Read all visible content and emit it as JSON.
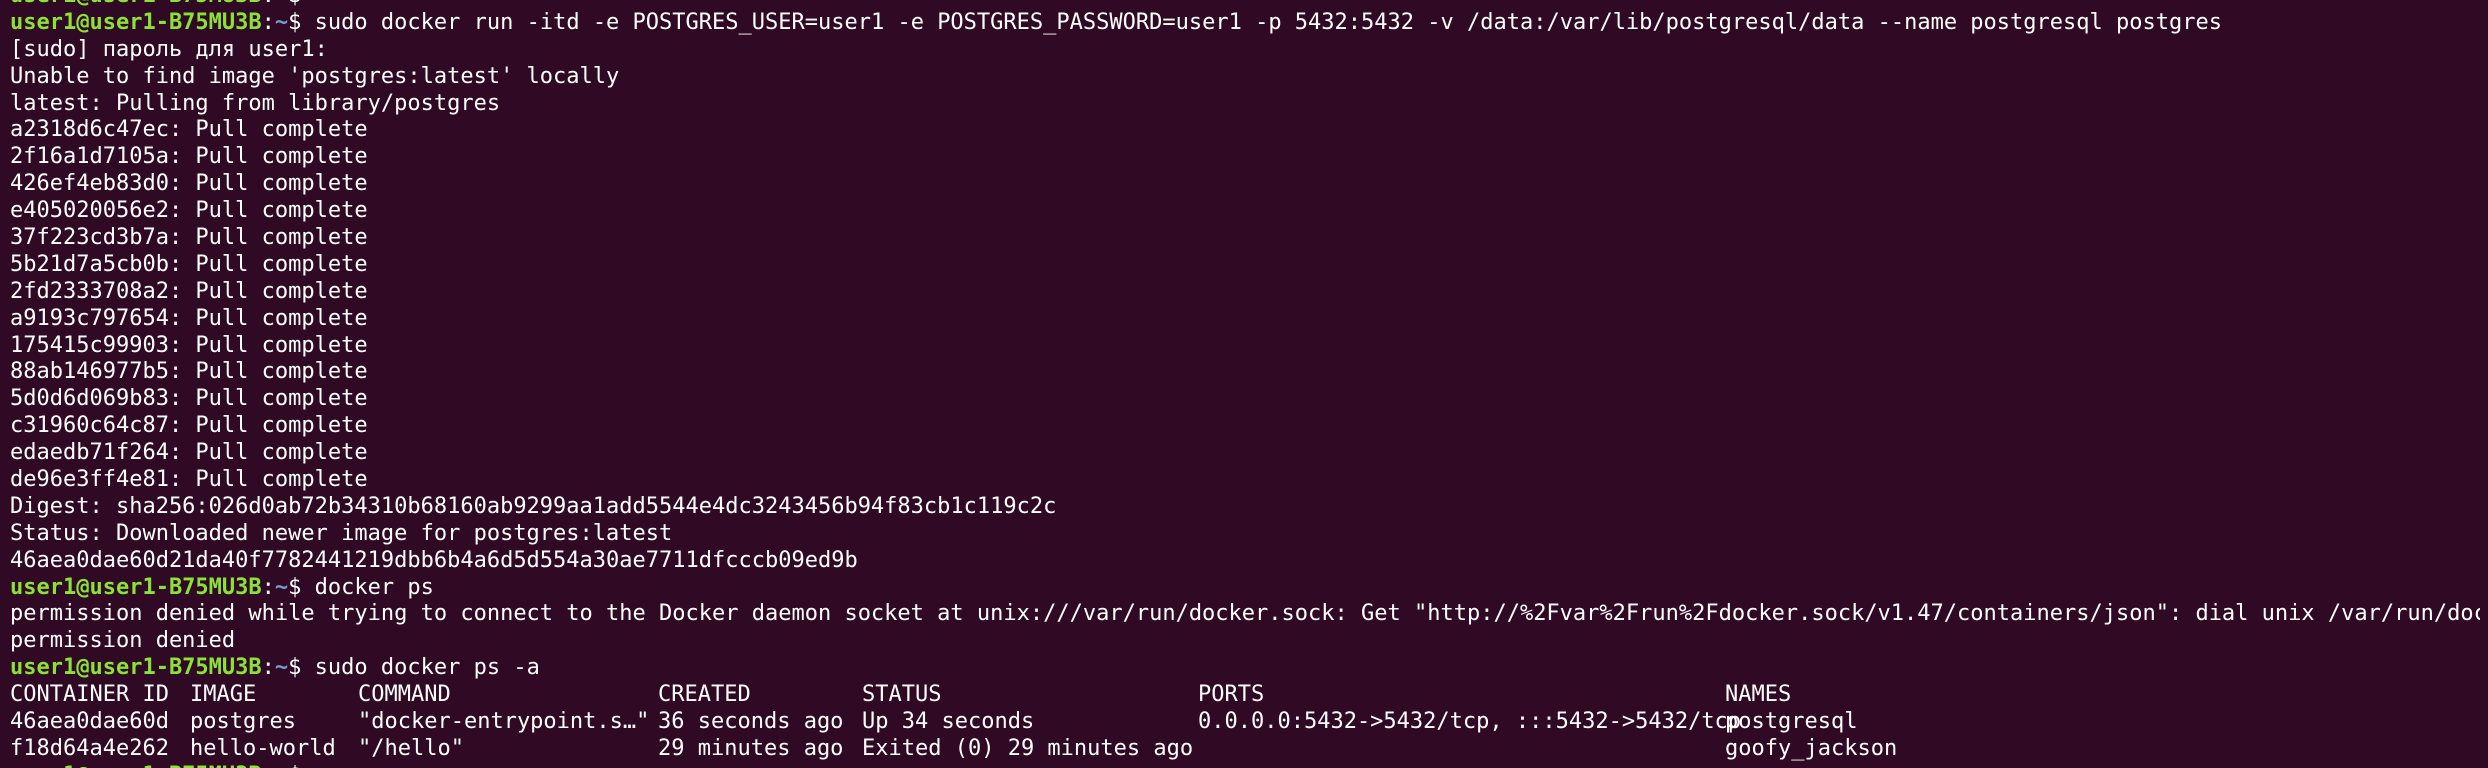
{
  "prompt": {
    "user_host": "user1@user1-B75MU3B",
    "path": "~",
    "symbol": "$"
  },
  "top_partial_line": "user1@user1-B75MU3B:~$ ...",
  "commands": {
    "run": " sudo docker run -itd -e POSTGRES_USER=user1 -e POSTGRES_PASSWORD=user1 -p 5432:5432 -v /data:/var/lib/postgresql/data --name postgresql postgres",
    "ps": " docker ps",
    "ps_a": " sudo docker ps -a"
  },
  "run_output": [
    "[sudo] пароль для user1:",
    "Unable to find image 'postgres:latest' locally",
    "latest: Pulling from library/postgres",
    "a2318d6c47ec: Pull complete",
    "2f16a1d7105a: Pull complete",
    "426ef4eb83d0: Pull complete",
    "e405020056e2: Pull complete",
    "37f223cd3b7a: Pull complete",
    "5b21d7a5cb0b: Pull complete",
    "2fd2333708a2: Pull complete",
    "a9193c797654: Pull complete",
    "175415c99903: Pull complete",
    "88ab146977b5: Pull complete",
    "5d0d6d069b83: Pull complete",
    "c31960c64c87: Pull complete",
    "edaedb71f264: Pull complete",
    "de96e3ff4e81: Pull complete",
    "Digest: sha256:026d0ab72b34310b68160ab9299aa1add5544e4dc3243456b94f83cb1c119c2c",
    "Status: Downloaded newer image for postgres:latest",
    "46aea0dae60d21da40f7782441219dbb6b4a6d5d554a30ae7711dfcccb09ed9b"
  ],
  "ps_output": [
    "permission denied while trying to connect to the Docker daemon socket at unix:///var/run/docker.sock: Get \"http://%2Fvar%2Frun%2Fdocker.sock/v1.47/containers/json\": dial unix /var/run/docker.sock: connect:",
    "permission denied"
  ],
  "ps_table": {
    "headers": [
      "CONTAINER ID",
      "IMAGE",
      "COMMAND",
      "CREATED",
      "STATUS",
      "PORTS",
      "NAMES"
    ],
    "rows": [
      [
        "46aea0dae60d",
        "postgres",
        "\"docker-entrypoint.s…\"",
        "36 seconds ago",
        "Up 34 seconds",
        "0.0.0.0:5432->5432/tcp, :::5432->5432/tcp",
        "postgresql"
      ],
      [
        "f18d64a4e262",
        "hello-world",
        "\"/hello\"",
        "29 minutes ago",
        "Exited (0) 29 minutes ago",
        "",
        "goofy_jackson"
      ]
    ]
  },
  "colors": {
    "background": "#300a24",
    "prompt_user": "#8ae234",
    "prompt_path": "#729fcf",
    "text": "#ffffff"
  }
}
